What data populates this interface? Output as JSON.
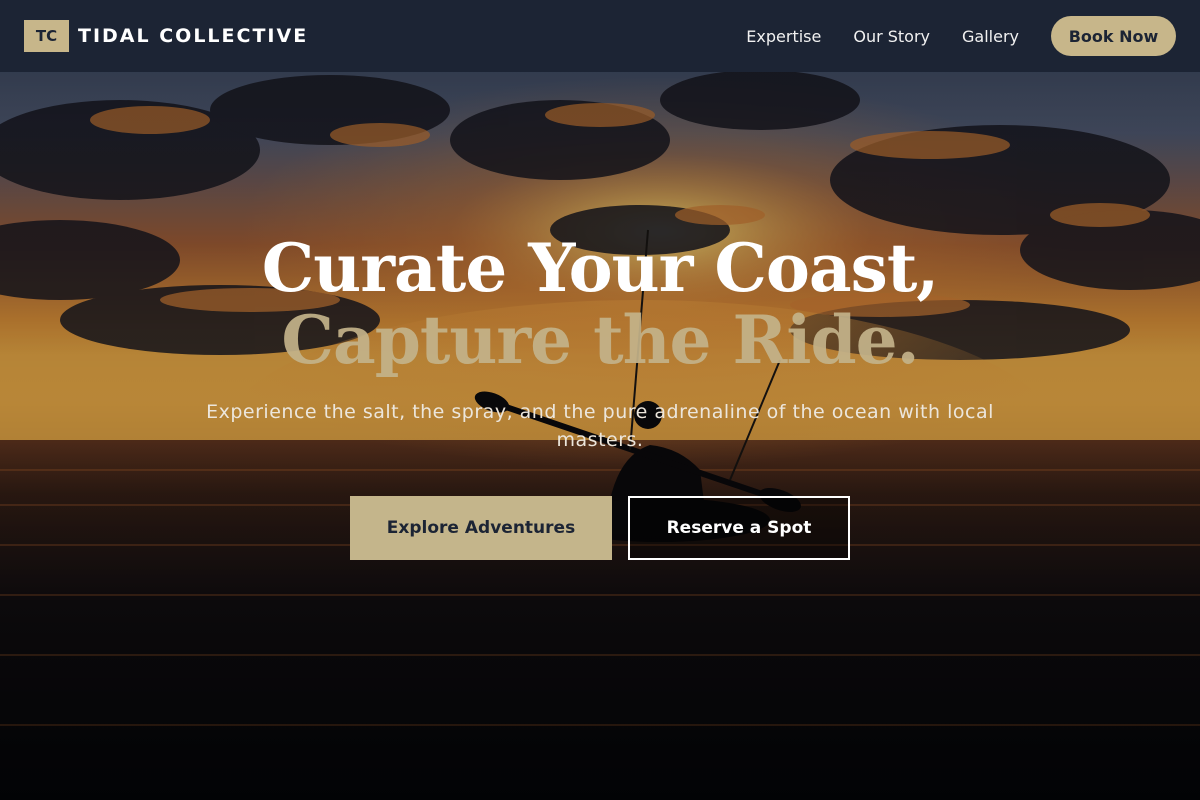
{
  "brand": {
    "badge": "TC",
    "name": "TIDAL COLLECTIVE"
  },
  "nav": {
    "links": [
      "Expertise",
      "Our Story",
      "Gallery"
    ],
    "book_label": "Book Now"
  },
  "hero": {
    "headline_line1": "Curate Your Coast,",
    "headline_line2": "Capture the Ride.",
    "subtitle": "Experience the salt, the spray, and the pure adrenaline of the ocean with local masters.",
    "primary_cta": "Explore Adventures",
    "secondary_cta": "Reserve a Spot"
  },
  "colors": {
    "nav_bg": "#1c2434",
    "accent_gold": "#c7b68a",
    "text_light": "#ffffff"
  },
  "icons": {
    "logo": "tc-monogram"
  }
}
